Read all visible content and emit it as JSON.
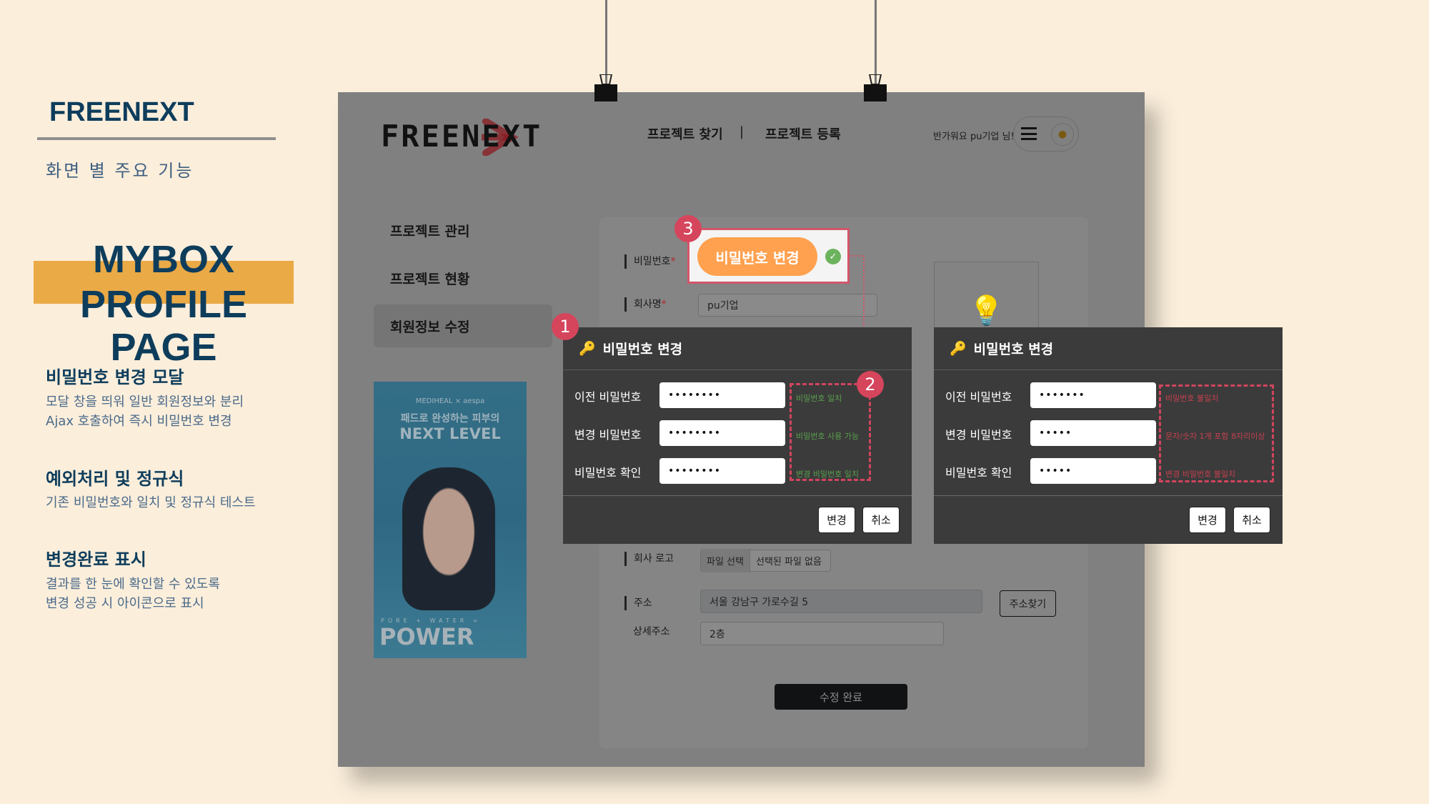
{
  "left": {
    "brand": "FREENEXT",
    "subtitle": "화면 별 주요 기능",
    "heading_1": "MYBOX",
    "heading_2": "PROFILE PAGE",
    "sections": [
      {
        "title": "비밀번호 변경 모달",
        "lines": [
          "모달 창을 띄워 일반 회원정보와 분리",
          "Ajax 호출하여 즉시 비밀번호 변경"
        ]
      },
      {
        "title": "예외처리 및 정규식",
        "lines": [
          "기존 비밀번호와 일치 및 정규식 테스트"
        ]
      },
      {
        "title": "변경완료 표시",
        "lines": [
          "결과를 한 눈에 확인할 수 있도록",
          "변경 성공 시 아이콘으로 표시"
        ]
      }
    ]
  },
  "app": {
    "logo": "FREENEXT",
    "nav": [
      "프로젝트 찾기",
      "프로젝트 등록"
    ],
    "nav_sep": "|",
    "greeting": "반가워요 pu기업 님!",
    "sidebar": [
      "프로젝트 관리",
      "프로젝트 현황",
      "회원정보 수정"
    ],
    "sidebar_active": 2,
    "ad": {
      "brand": "MEDIHEAL × aespa",
      "line1": "패드로 완성하는 피부의",
      "line2": "NEXT LEVEL",
      "tag": "PORE + WATER =",
      "headline": "POWER"
    },
    "form": {
      "password_label": "비밀번호",
      "company_label": "회사명",
      "required": "*",
      "company_value": "pu기업",
      "change_pw_button": "비밀번호 변경",
      "logo_label": "회사 로고",
      "file_button": "파일 선택",
      "file_status": "선택된 파일 없음",
      "address_label": "주소",
      "address_value": "서울 강남구 가로수길 5",
      "address_button": "주소찾기",
      "detail_label": "상세주소",
      "detail_value": "2층",
      "submit": "수정 완료"
    }
  },
  "modals": [
    {
      "title": "비밀번호 변경",
      "labels": [
        "이전 비밀번호",
        "변경 비밀번호",
        "비밀번호 확인"
      ],
      "values": [
        "••••••••",
        "••••••••",
        "••••••••"
      ],
      "messages": [
        "비밀번호 일치",
        "비밀번호 사용 가능",
        "변경 비밀번호 일치"
      ],
      "message_color": "#5aa04c",
      "ok": "변경",
      "cancel": "취소"
    },
    {
      "title": "비밀번호 변경",
      "labels": [
        "이전 비밀번호",
        "변경 비밀번호",
        "비밀번호 확인"
      ],
      "values": [
        "•••••••",
        "•••••",
        "•••••"
      ],
      "messages": [
        "비밀번호 불일치",
        "문자/숫자 1개 포함 8자리이상",
        "변경 비밀번호 불일치"
      ],
      "message_color": "#c4404f",
      "ok": "변경",
      "cancel": "취소"
    }
  ],
  "badges": [
    "1",
    "2",
    "3"
  ],
  "colors": {
    "accent": "#eaaa46",
    "navy": "#0e3d5c",
    "marker": "#d5455c",
    "button_orange": "#ffa14f"
  }
}
